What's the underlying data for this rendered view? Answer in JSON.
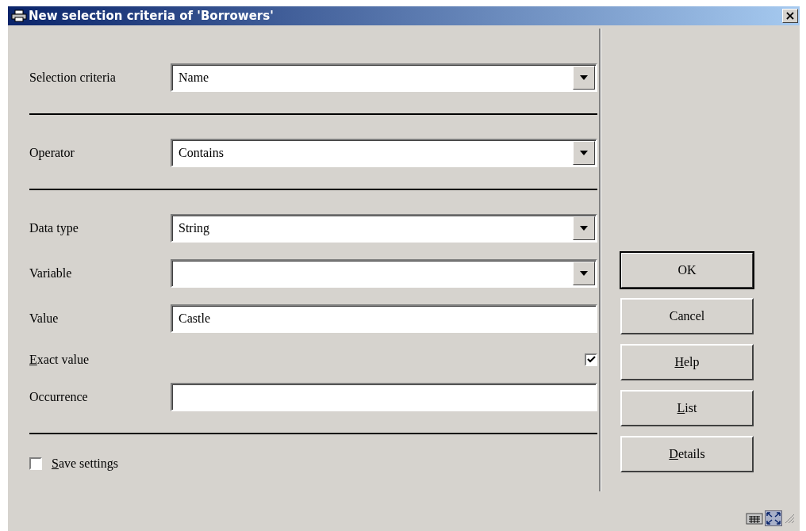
{
  "window": {
    "title": "New selection criteria of 'Borrowers'",
    "close": "×"
  },
  "rows": [
    {
      "kind": "dropdown",
      "label": "Selection criteria",
      "value": "Name"
    },
    {
      "kind": "divider"
    },
    {
      "kind": "dropdown",
      "label": "Operator",
      "value": "Contains"
    },
    {
      "kind": "divider"
    },
    {
      "kind": "dropdown",
      "label": "Data type",
      "value": "String"
    },
    {
      "kind": "dropdown",
      "label": "Variable"
    },
    {
      "kind": "text",
      "label": "Value",
      "value": "Castle"
    },
    {
      "kind": "checkbox",
      "label": "Exact value",
      "underline_first": true,
      "checked": true
    },
    {
      "kind": "text",
      "label": "Occurrence"
    },
    {
      "kind": "divider"
    }
  ],
  "save_settings": {
    "label": "Save settings",
    "underline_first": true,
    "checked": false
  },
  "buttons": [
    {
      "label": "OK",
      "default": true,
      "underline_first": false
    },
    {
      "label": "Cancel",
      "default": false,
      "underline_first": false
    },
    {
      "label": "Help",
      "default": false,
      "underline_first": true
    },
    {
      "label": "List",
      "default": false,
      "underline_first": true
    },
    {
      "label": "Details",
      "default": false,
      "underline_first": true
    }
  ]
}
